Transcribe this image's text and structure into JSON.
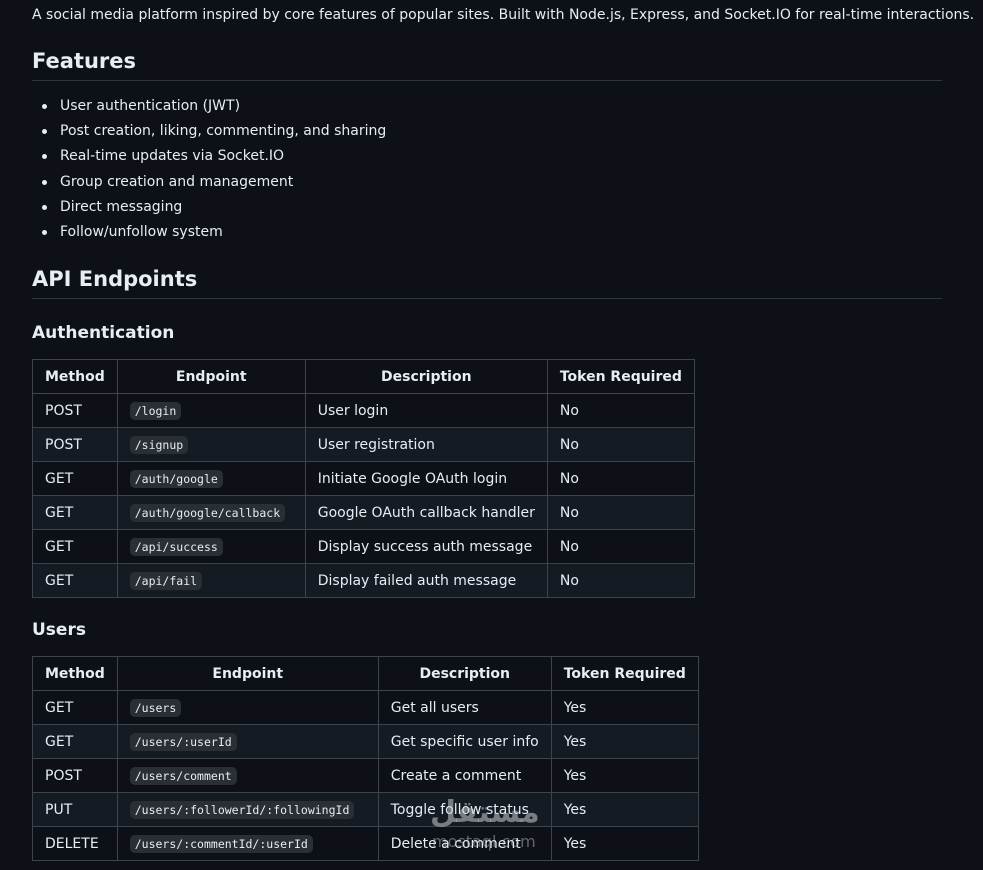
{
  "intro": "A social media platform inspired by core features of popular sites. Built with Node.js, Express, and Socket.IO for real-time interactions.",
  "features": {
    "heading": "Features",
    "items": [
      "User authentication (JWT)",
      "Post creation, liking, commenting, and sharing",
      "Real-time updates via Socket.IO",
      "Group creation and management",
      "Direct messaging",
      "Follow/unfollow system"
    ]
  },
  "api": {
    "heading": "API Endpoints",
    "auth": {
      "heading": "Authentication",
      "headers": [
        "Method",
        "Endpoint",
        "Description",
        "Token Required"
      ],
      "rows": [
        {
          "method": "POST",
          "endpoint": "/login",
          "description": "User login",
          "token": "No"
        },
        {
          "method": "POST",
          "endpoint": "/signup",
          "description": "User registration",
          "token": "No"
        },
        {
          "method": "GET",
          "endpoint": "/auth/google",
          "description": "Initiate Google OAuth login",
          "token": "No"
        },
        {
          "method": "GET",
          "endpoint": "/auth/google/callback",
          "description": "Google OAuth callback handler",
          "token": "No"
        },
        {
          "method": "GET",
          "endpoint": "/api/success",
          "description": "Display success auth message",
          "token": "No"
        },
        {
          "method": "GET",
          "endpoint": "/api/fail",
          "description": "Display failed auth message",
          "token": "No"
        }
      ]
    },
    "users": {
      "heading": "Users",
      "headers": [
        "Method",
        "Endpoint",
        "Description",
        "Token Required"
      ],
      "rows": [
        {
          "method": "GET",
          "endpoint": "/users",
          "description": "Get all users",
          "token": "Yes"
        },
        {
          "method": "GET",
          "endpoint": "/users/:userId",
          "description": "Get specific user info",
          "token": "Yes"
        },
        {
          "method": "POST",
          "endpoint": "/users/comment",
          "description": "Create a comment",
          "token": "Yes"
        },
        {
          "method": "PUT",
          "endpoint": "/users/:followerId/:followingId",
          "description": "Toggle follow status",
          "token": "Yes"
        },
        {
          "method": "DELETE",
          "endpoint": "/users/:commentId/:userId",
          "description": "Delete a comment",
          "token": "Yes"
        }
      ]
    }
  },
  "watermark": {
    "text": "مستقل",
    "sub": "mostaql.com"
  }
}
